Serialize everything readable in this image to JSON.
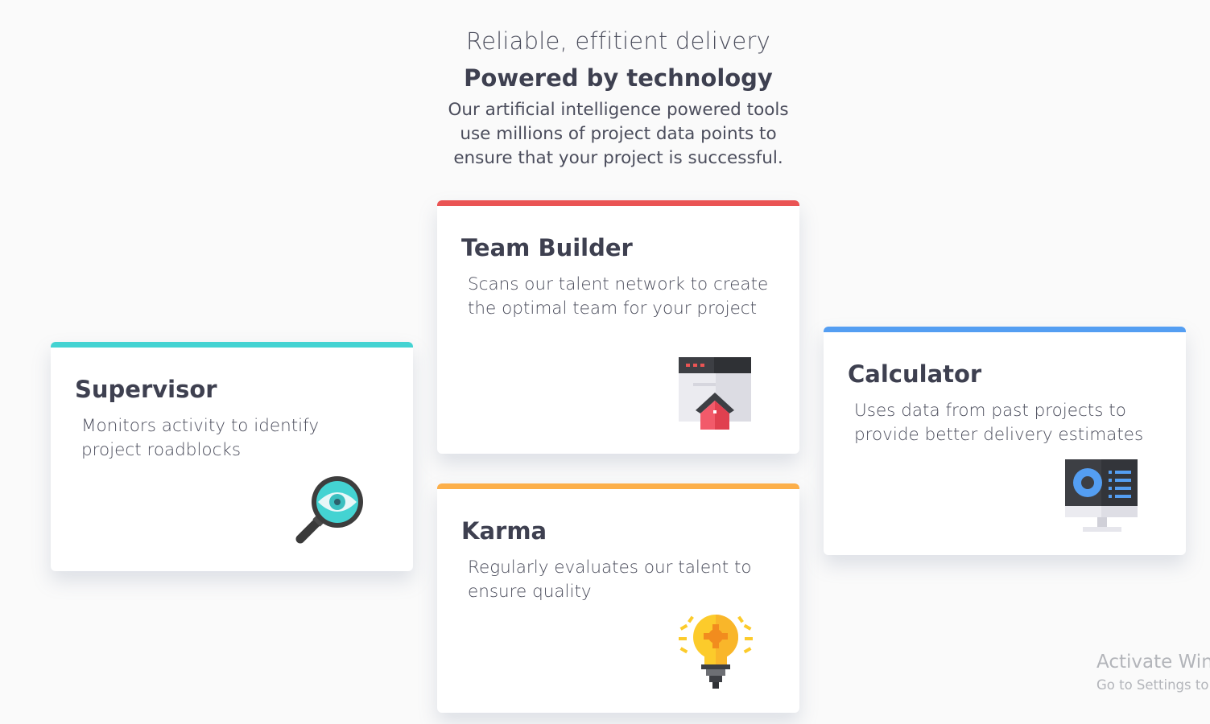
{
  "header": {
    "subtitle": "Reliable, effitient delivery",
    "title": "Powered by technology",
    "description": "Our artificial intelligence powered tools use millions of project data points to ensure that your project is successful."
  },
  "cards": {
    "supervisor": {
      "title": "Supervisor",
      "description": "Monitors activity to identify project roadblocks",
      "accent": "#44d3d2",
      "icon": "magnifier-eye-icon"
    },
    "team_builder": {
      "title": "Team Builder",
      "description": "Scans our talent network to create the optimal team for your project",
      "accent": "#ea5454",
      "icon": "browser-house-icon"
    },
    "calculator": {
      "title": "Calculator",
      "description": "Uses data from past projects to provide better delivery estimates",
      "accent": "#549ef2",
      "icon": "monitor-chart-icon"
    },
    "karma": {
      "title": "Karma",
      "description": "Regularly evaluates our talent to ensure quality",
      "accent": "#fcaf4a",
      "icon": "lightbulb-icon"
    }
  },
  "watermark": {
    "line1": "Activate Wind",
    "line2": "Go to Settings to"
  }
}
